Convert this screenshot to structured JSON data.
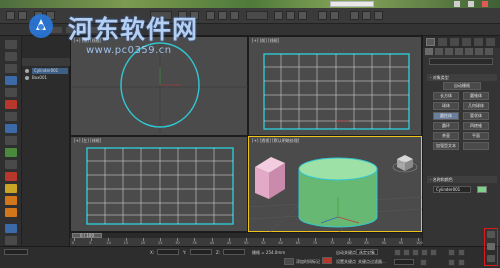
{
  "window": {
    "title": "",
    "search_placeholder": "",
    "quick_access": ""
  },
  "watermark": {
    "title": "河东软件网",
    "url": "www.pc0359.cn"
  },
  "explorer": {
    "header": "",
    "items": [
      {
        "label": "Cylinder001"
      },
      {
        "label": "Box001"
      }
    ]
  },
  "viewports": {
    "top_left": {
      "label": "[+] [顶] [线框]"
    },
    "top_right": {
      "label": "[+] [前] [线框]"
    },
    "bottom_left": {
      "label": "[+] [左] [线框]"
    },
    "bottom_right": {
      "label": "[+] [透视] [默认明暗处理]"
    }
  },
  "command_panel": {
    "dropdown": "",
    "section_object_type": "- 对象类型",
    "autogrid": "自动栅格",
    "buttons": [
      "长方体",
      "圆锥体",
      "球体",
      "几何球体",
      "圆柱体",
      "管状体",
      "圆环",
      "四棱锥",
      "茶壶",
      "平面",
      "加强型文本",
      ""
    ],
    "section_name_color": "- 名称和颜色",
    "object_name": "Cylinder001",
    "object_color": "#7fd18a"
  },
  "timeline": {
    "frame_display": "0 / 100",
    "ticks": [
      "0",
      "5",
      "10",
      "15",
      "20",
      "25",
      "30",
      "35",
      "40",
      "45",
      "50",
      "55",
      "60",
      "65",
      "70",
      "75",
      "80",
      "85",
      "90",
      "95",
      "100"
    ]
  },
  "statusbar": {
    "mode": "",
    "selection": "",
    "hint": "",
    "x_label": "X:",
    "y_label": "Y:",
    "z_label": "Z:",
    "grid": "栅格 = 254.0mm",
    "auto_key": "自动关键点",
    "set_key": "设置关键点",
    "selected": "选定对象",
    "key_filter": "关键点过滤器...",
    "add_time_tag": "添加时间标记"
  },
  "colors": {
    "accent_selection": "#31c7d4",
    "cylinder_fill": "#7fd18a",
    "box_fill": "#e8b6cf",
    "active_viewport_border": "#f0c21a",
    "highlight_red": "#e01818"
  }
}
